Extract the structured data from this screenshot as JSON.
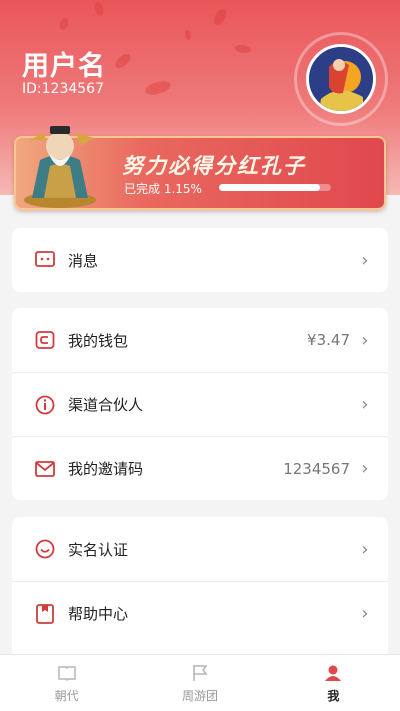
{
  "header": {
    "username": "用户名",
    "user_id": "ID:1234567",
    "avatar": "avatar-illustration"
  },
  "banner": {
    "title": "努力必得分红孔子",
    "progress_text": "已完成 1.15%",
    "progress": 0.0115,
    "mascot": "confucius-mascot"
  },
  "menu": {
    "group1": [
      {
        "label": "消息",
        "icon": "message-icon"
      }
    ],
    "group2": [
      {
        "label": "我的钱包",
        "value": "¥3.47",
        "icon": "wallet-icon"
      },
      {
        "label": "渠道合伙人",
        "icon": "info-icon"
      },
      {
        "label": "我的邀请码",
        "value": "1234567",
        "icon": "mail-icon"
      }
    ],
    "group3": [
      {
        "label": "实名认证",
        "icon": "smile-icon"
      },
      {
        "label": "帮助中心",
        "icon": "bookmark-icon"
      }
    ]
  },
  "tabbar": [
    {
      "label": "朝代",
      "icon": "book-icon",
      "active": false
    },
    {
      "label": "周游团",
      "icon": "flag-icon",
      "active": false
    },
    {
      "label": "我",
      "icon": "user-icon",
      "active": true
    }
  ],
  "colors": {
    "accent": "#e0484e",
    "header": "#e9565a"
  }
}
